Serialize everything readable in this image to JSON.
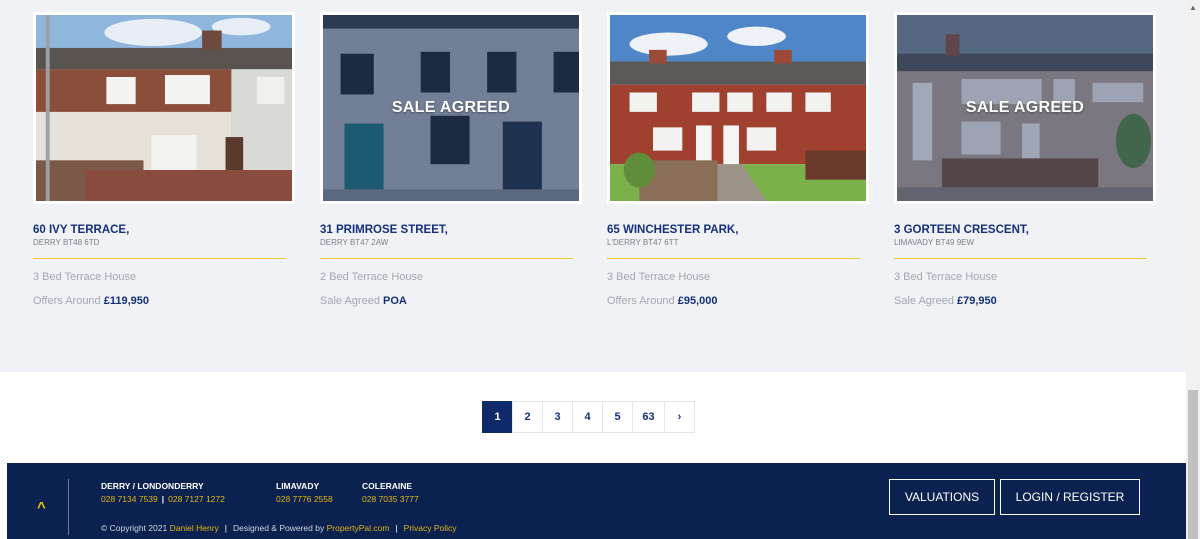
{
  "listings": [
    {
      "address": "60 IVY TERRACE,",
      "town": "DERRY BT48 6TD",
      "type": "3 Bed Terrace House",
      "price_label": "Offers Around",
      "price": "£119,950",
      "badge": ""
    },
    {
      "address": "31 PRIMROSE STREET,",
      "town": "DERRY BT47 2AW",
      "type": "2 Bed Terrace House",
      "price_label": "Sale Agreed",
      "price": "POA",
      "badge": "SALE AGREED"
    },
    {
      "address": "65 WINCHESTER PARK,",
      "town": "L'DERRY BT47 6TT",
      "type": "3 Bed Terrace House",
      "price_label": "Offers Around",
      "price": "£95,000",
      "badge": ""
    },
    {
      "address": "3 GORTEEN CRESCENT,",
      "town": "LIMAVADY BT49 9EW",
      "type": "3 Bed Terrace House",
      "price_label": "Sale Agreed",
      "price": "£79,950",
      "badge": "SALE AGREED"
    }
  ],
  "pagination": {
    "pages": [
      "1",
      "2",
      "3",
      "4",
      "5",
      "63"
    ],
    "current": "1",
    "next": "›"
  },
  "footer": {
    "offices": [
      {
        "name": "DERRY / LONDONDERRY",
        "phone1": "028 7134 7539",
        "separator": "|",
        "phone2": "028 7127 1272"
      },
      {
        "name": "LIMAVADY",
        "phone1": "028 7776 2558"
      },
      {
        "name": "COLERAINE",
        "phone1": "028 7035 3777"
      }
    ],
    "copyright_prefix": "© Copyright 2021",
    "company": "Daniel Henry",
    "designed_by": "Designed & Powered by",
    "designer": "PropertyPal.com",
    "privacy": "Privacy Policy",
    "divider": "|",
    "valuations_label": "VALUATIONS",
    "login_label": "LOGIN / REGISTER",
    "to_top_glyph": "^"
  },
  "colors": {
    "navy": "#0b2150",
    "link_blue": "#16307a",
    "gold": "#e2b614"
  },
  "icons": {
    "scroll_up": "triangle-up-icon",
    "to_top": "chevron-up-icon",
    "next_page": "chevron-right-icon"
  }
}
